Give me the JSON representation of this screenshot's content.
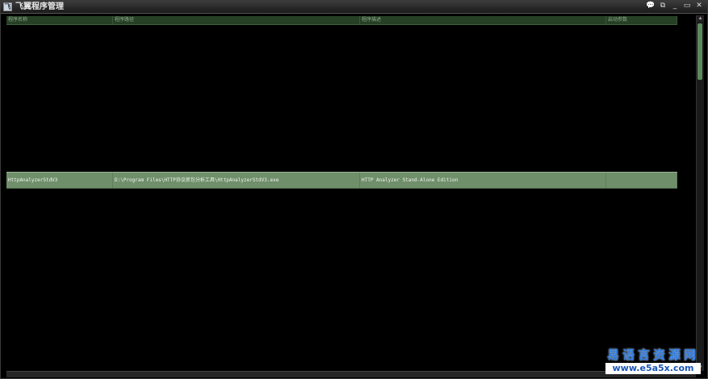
{
  "window": {
    "title": "飞翼程序管理",
    "icon_label": "飞"
  },
  "window_controls": [
    {
      "name": "chat-icon",
      "glyph": "💬"
    },
    {
      "name": "restore-icon",
      "glyph": "⧉"
    },
    {
      "name": "minimize-icon",
      "glyph": "_"
    },
    {
      "name": "maximize-icon",
      "glyph": "▭"
    },
    {
      "name": "close-icon",
      "glyph": "✕"
    }
  ],
  "table": {
    "headers": [
      "程序名称",
      "程序路径",
      "程序描述",
      "启动参数"
    ],
    "rows": [
      [
        "HttpAnalyzerStdV3",
        "D:\\Program Files\\HTTP协议抓包分析工具\\HttpAnalyzerStdV3.exe",
        "HTTP Analyzer Stand-Alone Edition",
        ""
      ]
    ]
  },
  "scrollbar": {
    "up": "▲",
    "down": "▼"
  },
  "watermark": {
    "cn": "易语言资源网",
    "url": "www.e5a5x.com"
  },
  "colors": {
    "header_bg": "#254025",
    "row_selected": "#6f8f6a",
    "watermark_blue": "#2f7de1"
  }
}
